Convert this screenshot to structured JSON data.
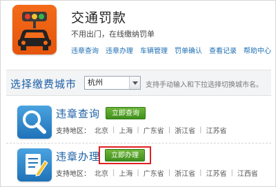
{
  "header": {
    "title": "交通罚款",
    "subtitle": "不用出门，在线缴纳罚单",
    "nav": [
      "违章查询",
      "违章办理",
      "车辆管理",
      "罚单确认",
      "查看记录",
      "帮助中心"
    ]
  },
  "city_bar": {
    "label": "选择缴费城市",
    "selected_city": "杭州",
    "hint": "支持手动输入和下拉选择切换城市名。"
  },
  "services": [
    {
      "title": "违章查询",
      "button": "立即查询",
      "support_label": "支持地区：",
      "cities": [
        "北京",
        "上海",
        "广东省",
        "浙江省",
        "江苏省"
      ],
      "icon": "magnifier-icon"
    },
    {
      "title": "违章办理",
      "button": "立即办理",
      "support_label": "支持地区：",
      "cities": [
        "北京",
        "上海",
        "广东省",
        "浙江省",
        "江苏省",
        "江西省"
      ],
      "icon": "document-pen-icon"
    }
  ],
  "colors": {
    "brand_orange": "#f36b19",
    "link_blue": "#1f6fb3",
    "button_green": "#4c9e24",
    "highlight_red": "#e0201f"
  }
}
